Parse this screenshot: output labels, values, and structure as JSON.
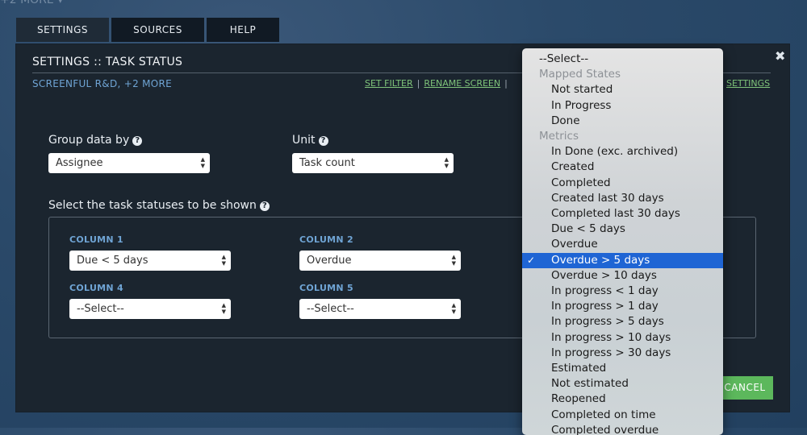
{
  "top_crumb": "+2 MORE ▾",
  "tabs": [
    {
      "label": "SETTINGS"
    },
    {
      "label": "SOURCES"
    },
    {
      "label": "HELP"
    }
  ],
  "panel": {
    "title": "SETTINGS :: TASK STATUS",
    "subtitle": "SCREENFUL R&D, +2 MORE",
    "links": [
      "SET FILTER",
      "RENAME SCREEN"
    ],
    "settings_link": "SETTINGS",
    "close": "✖"
  },
  "group_by": {
    "label": "Group data by",
    "value": "Assignee"
  },
  "unit": {
    "label": "Unit",
    "value": "Task count"
  },
  "statuses_label": "Select the task statuses to be shown",
  "columns": [
    {
      "label": "COLUMN 1",
      "value": "Due < 5 days"
    },
    {
      "label": "COLUMN 2",
      "value": "Overdue"
    },
    {
      "label": "COLUMN 4",
      "value": "--Select--"
    },
    {
      "label": "COLUMN 5",
      "value": "--Select--"
    }
  ],
  "cancel_label": "CANCEL",
  "help_glyph": "?",
  "menu": {
    "top": "--Select--",
    "groups": [
      {
        "label": "Mapped States",
        "options": [
          "Not started",
          "In Progress",
          "Done"
        ]
      },
      {
        "label": "Metrics",
        "options": [
          "In Done (exc. archived)",
          "Created",
          "Completed",
          "Created last 30 days",
          "Completed last 30 days",
          "Due < 5 days",
          "Overdue",
          "Overdue > 5 days",
          "Overdue > 10 days",
          "In progress < 1 day",
          "In progress > 1 day",
          "In progress > 5 days",
          "In progress > 10 days",
          "In progress > 30 days",
          "Estimated",
          "Not estimated",
          "Reopened",
          "Completed on time",
          "Completed overdue"
        ]
      }
    ],
    "selected": "Overdue > 5 days",
    "check": "✓"
  }
}
